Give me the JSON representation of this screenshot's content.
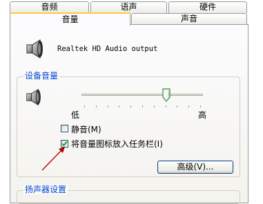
{
  "tabs_row1": [
    {
      "label": "音频"
    },
    {
      "label": "语声"
    },
    {
      "label": "硬件"
    }
  ],
  "tabs_row2": [
    {
      "label": "音量",
      "active": true
    },
    {
      "label": "声音",
      "active": false
    }
  ],
  "device": {
    "name": "Realtek HD Audio output",
    "icon": "speaker-icon"
  },
  "device_volume": {
    "group_title": "设备音量",
    "icon": "speaker-icon",
    "slider_level": 0.7,
    "low_label": "低",
    "high_label": "高",
    "mute": {
      "label": "静音(M)",
      "checked": false
    },
    "taskbar": {
      "label": "将音量图标放入任务栏(I)",
      "checked": true
    },
    "advanced_button": "高级(V)..."
  },
  "speaker_settings": {
    "group_title": "扬声器设置"
  },
  "colors": {
    "group_title": "#0046d5",
    "active_tab_highlight": "#ffc83c",
    "annotation_arrow": "#b00000"
  }
}
